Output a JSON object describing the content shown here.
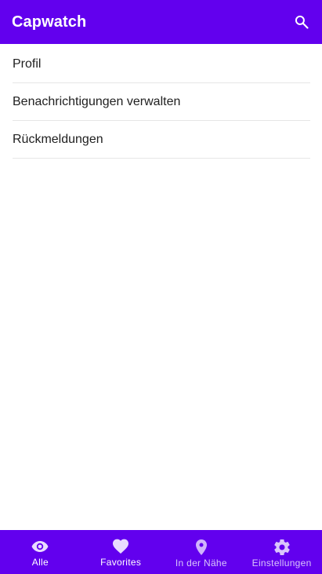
{
  "app_bar": {
    "title": "Capwatch",
    "search_icon": "search-icon",
    "color": "#6200ee"
  },
  "settings": {
    "items": [
      {
        "label": "Profil"
      },
      {
        "label": "Benachrichtigungen verwalten"
      },
      {
        "label": "Rückmeldungen"
      }
    ]
  },
  "bottom_nav": {
    "items": [
      {
        "label": "Alle",
        "icon": "eye-icon",
        "active": true
      },
      {
        "label": "Favorites",
        "icon": "heart-icon",
        "active": true
      },
      {
        "label": "In der Nähe",
        "icon": "location-pin-icon",
        "active": false
      },
      {
        "label": "Einstellungen",
        "icon": "gear-icon",
        "active": false
      }
    ]
  }
}
